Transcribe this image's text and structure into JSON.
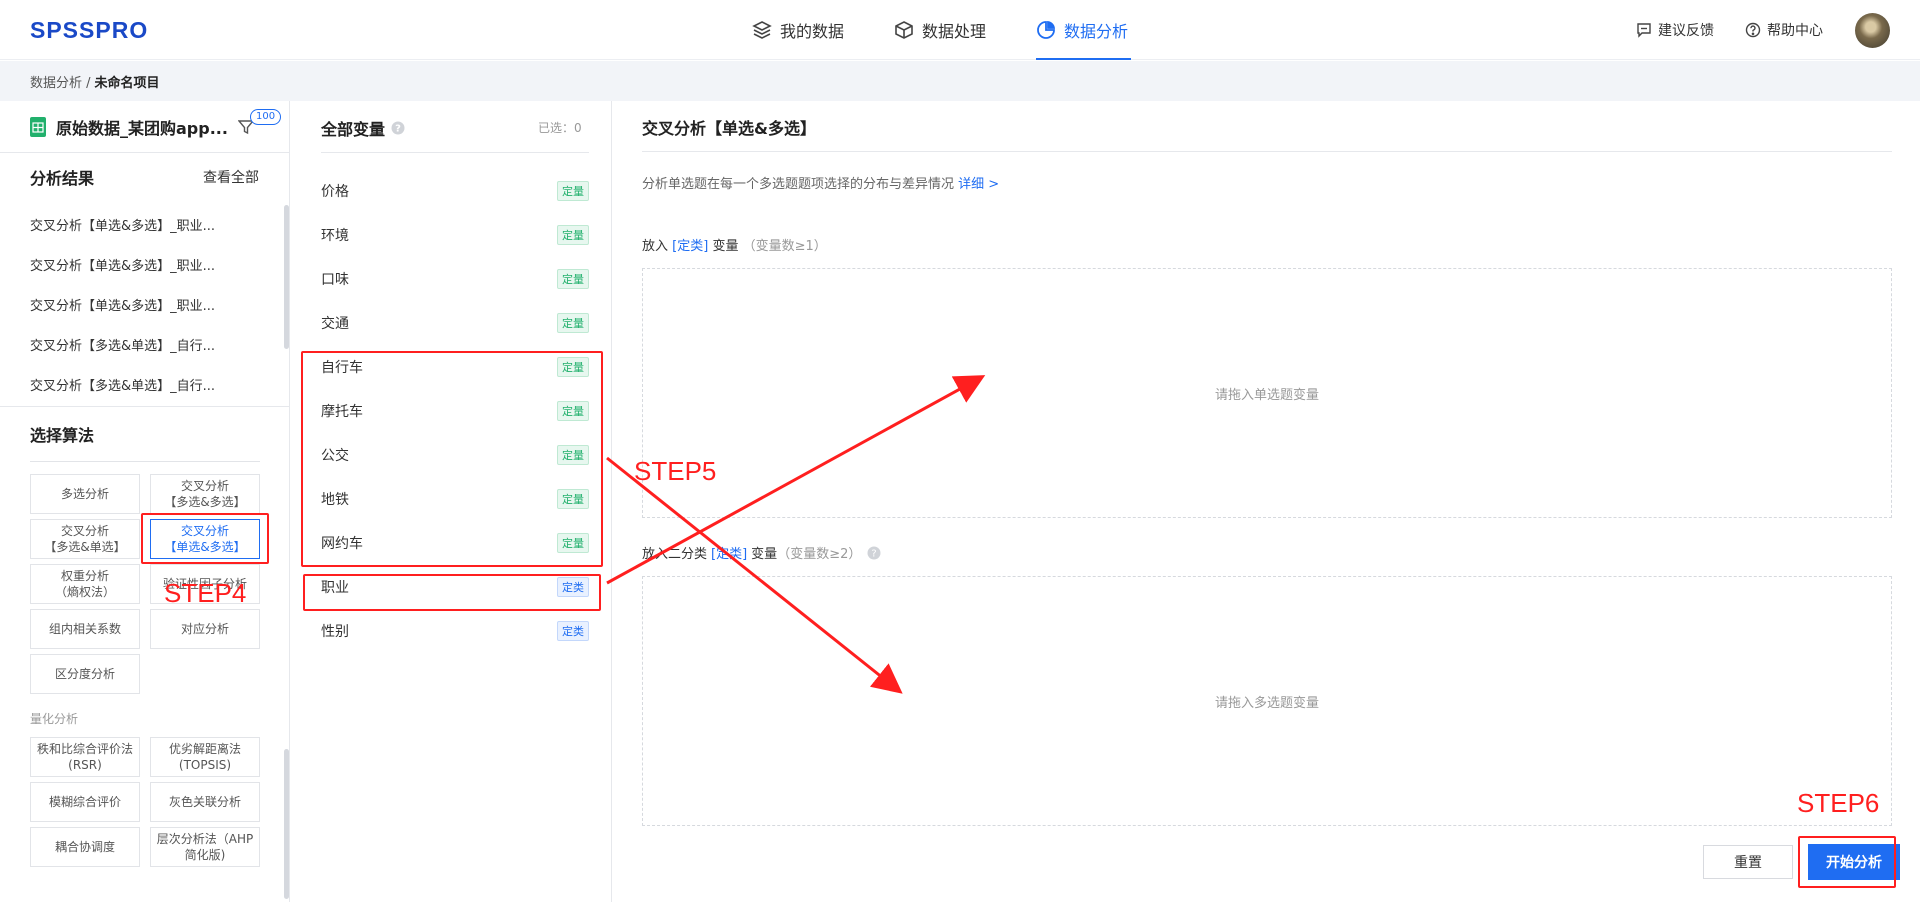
{
  "app": {
    "logo": "SPSSPRO"
  },
  "nav": [
    {
      "label": "我的数据",
      "icon": "layers-icon"
    },
    {
      "label": "数据处理",
      "icon": "cube-icon"
    },
    {
      "label": "数据分析",
      "icon": "pie-chart-icon",
      "active": true
    }
  ],
  "header_right": {
    "feedback": "建议反馈",
    "help": "帮助中心"
  },
  "breadcrumb": {
    "root": "数据分析 /",
    "current": "未命名项目"
  },
  "dataset": {
    "title": "原始数据_某团购app...",
    "badge": "100"
  },
  "results": {
    "title": "分析结果",
    "view_all": "查看全部",
    "items": [
      "交叉分析【单选&多选】_职业...",
      "交叉分析【单选&多选】_职业...",
      "交叉分析【单选&多选】_职业...",
      "交叉分析【多选&单选】_自行...",
      "交叉分析【多选&单选】_自行..."
    ]
  },
  "algorithms": {
    "title": "选择算法",
    "buttons": [
      {
        "label": "多选分析"
      },
      {
        "label": "交叉分析\n【多选&多选】"
      },
      {
        "label": "交叉分析\n【多选&单选】"
      },
      {
        "label": "交叉分析\n【单选&多选】",
        "active": true
      },
      {
        "label": "权重分析\n（熵权法）"
      },
      {
        "label": "验证性因子分析"
      },
      {
        "label": "组内相关系数"
      },
      {
        "label": "对应分析"
      },
      {
        "label": "区分度分析"
      }
    ],
    "group2_label": "量化分析",
    "group2": [
      {
        "label": "秩和比综合评价法\n(RSR)"
      },
      {
        "label": "优劣解距离法\n(TOPSIS)"
      },
      {
        "label": "模糊综合评价"
      },
      {
        "label": "灰色关联分析"
      },
      {
        "label": "耦合协调度"
      },
      {
        "label": "层次分析法（AHP\n简化版)"
      }
    ]
  },
  "variables": {
    "title": "全部变量",
    "selected": "已选：0",
    "items": [
      {
        "name": "价格",
        "tag": "定量",
        "kind": "q"
      },
      {
        "name": "环境",
        "tag": "定量",
        "kind": "q"
      },
      {
        "name": "口味",
        "tag": "定量",
        "kind": "q"
      },
      {
        "name": "交通",
        "tag": "定量",
        "kind": "q"
      },
      {
        "name": "自行车",
        "tag": "定量",
        "kind": "q"
      },
      {
        "name": "摩托车",
        "tag": "定量",
        "kind": "q"
      },
      {
        "name": "公交",
        "tag": "定量",
        "kind": "q"
      },
      {
        "name": "地铁",
        "tag": "定量",
        "kind": "q"
      },
      {
        "name": "网约车",
        "tag": "定量",
        "kind": "q"
      },
      {
        "name": "职业",
        "tag": "定类",
        "kind": "c"
      },
      {
        "name": "性别",
        "tag": "定类",
        "kind": "c"
      }
    ]
  },
  "analysis": {
    "title": "交叉分析【单选&多选】",
    "desc": "分析单选题在每一个多选题题项选择的分布与差异情况",
    "detail_link": "详细 >",
    "zone1": {
      "prefix": "放入",
      "type": "[定类]",
      "suffix": "变量",
      "hint": "（变量数≥1）",
      "placeholder": "请拖入单选题变量"
    },
    "zone2": {
      "prefix": "放入二分类",
      "type": "[定类]",
      "suffix": "变量",
      "hint": "（变量数≥2）",
      "placeholder": "请拖入多选题变量"
    },
    "reset": "重置",
    "start": "开始分析"
  },
  "annotations": {
    "step4": "STEP4",
    "step5": "STEP5",
    "step6": "STEP6"
  },
  "colors": {
    "brand": "#1a49c7",
    "accent": "#1f6df2",
    "annotation": "#ff1f1f"
  }
}
